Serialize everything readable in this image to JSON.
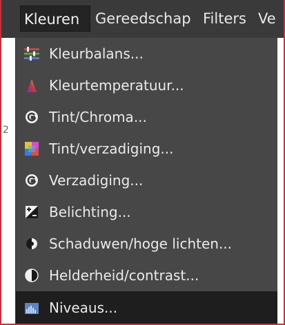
{
  "menubar": {
    "items": [
      {
        "label": "Kleuren",
        "active": true
      },
      {
        "label": "Gereedschap",
        "active": false
      },
      {
        "label": "Filters",
        "active": false
      },
      {
        "label": "Ve",
        "active": false
      }
    ]
  },
  "side_glyph": "2",
  "menu": {
    "items": [
      {
        "label": "Kleurbalans...",
        "icon": "color-balance-icon"
      },
      {
        "label": "Kleurtemperatuur...",
        "icon": "color-temperature-icon"
      },
      {
        "label": "Tint/Chroma...",
        "icon": "gegl-g-icon"
      },
      {
        "label": "Tint/verzadiging...",
        "icon": "hue-saturation-icon"
      },
      {
        "label": "Verzadiging...",
        "icon": "gegl-g-icon"
      },
      {
        "label": "Belichting...",
        "icon": "exposure-icon"
      },
      {
        "label": "Schaduwen/hoge lichten...",
        "icon": "shadows-highlights-icon"
      },
      {
        "label": "Helderheid/contrast...",
        "icon": "brightness-contrast-icon"
      },
      {
        "label": "Niveaus...",
        "icon": "levels-icon",
        "highlighted": true
      }
    ]
  },
  "colors": {
    "menubar_bg": "#3a3a3a",
    "menu_bg": "#474747",
    "highlight_bg": "#1e1e1e",
    "frame_border": "#c9303a",
    "text": "#eaeaea"
  }
}
